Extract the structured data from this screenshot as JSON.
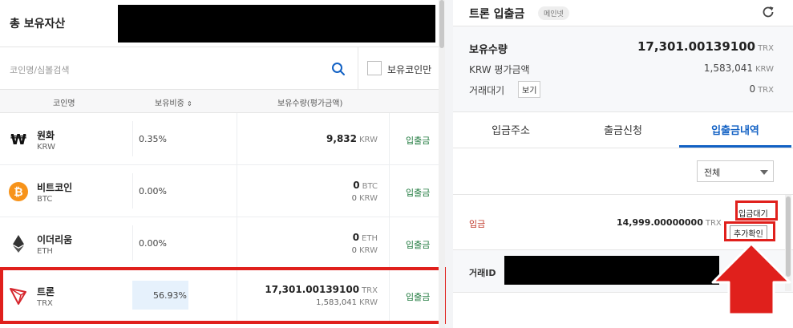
{
  "assets": {
    "title": "총 보유자산",
    "search_placeholder": "코인명/심볼검색",
    "owned_only_label": "보유코인만",
    "columns": [
      "코인명",
      "보유비중",
      "보유수량(평가금액)"
    ],
    "rows": [
      {
        "name": "원화",
        "symbol": "KRW",
        "share": "0.35%",
        "amount": "9,832",
        "amount_unit": "KRW",
        "krw": "",
        "krw_unit": "",
        "action": "입출금"
      },
      {
        "name": "비트코인",
        "symbol": "BTC",
        "share": "0.00%",
        "amount": "0",
        "amount_unit": "BTC",
        "krw": "0",
        "krw_unit": "KRW",
        "action": "입출금"
      },
      {
        "name": "이더리움",
        "symbol": "ETH",
        "share": "0.00%",
        "amount": "0",
        "amount_unit": "ETH",
        "krw": "0",
        "krw_unit": "KRW",
        "action": "입출금"
      },
      {
        "name": "트론",
        "symbol": "TRX",
        "share": "56.93%",
        "amount": "17,301.00139100",
        "amount_unit": "TRX",
        "krw": "1,583,041",
        "krw_unit": "KRW",
        "action": "입출금"
      }
    ]
  },
  "panel": {
    "title": "트론 입출금",
    "badge": "메인넷",
    "holdings_label": "보유수량",
    "holdings_value": "17,301.00139100",
    "holdings_unit": "TRX",
    "krw_label": "KRW 평가금액",
    "krw_value": "1,583,041",
    "krw_unit": "KRW",
    "pending_label": "거래대기",
    "view_button": "보기",
    "pending_value": "0",
    "pending_unit": "TRX",
    "tabs": [
      "입금주소",
      "출금신청",
      "입출금내역"
    ],
    "filter_value": "전체",
    "tx": {
      "type": "입금",
      "amount": "14,999.00000000",
      "unit": "TRX",
      "status1": "입금대기",
      "status2": "추가확인",
      "id_label": "거래ID"
    }
  },
  "colors": {
    "highlight": "#e0201c",
    "accent": "#1261c4",
    "action": "#1f7a3e"
  }
}
